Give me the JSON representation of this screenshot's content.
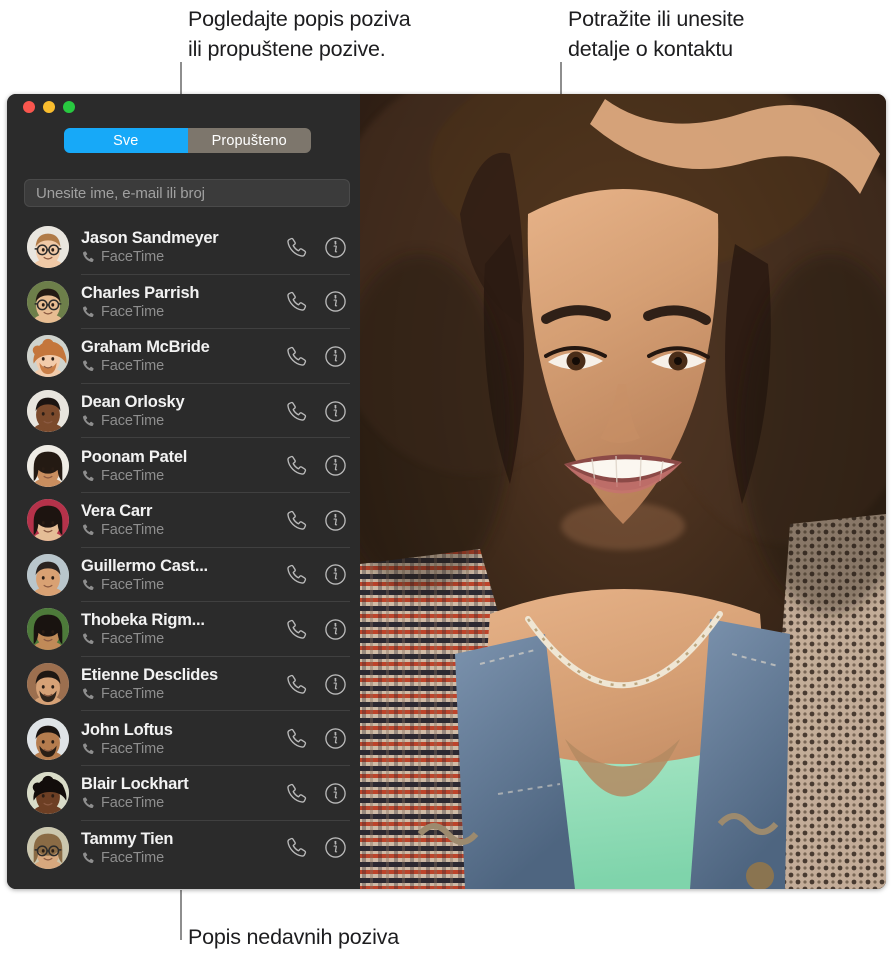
{
  "annotations": {
    "top_left": "Pogledajte popis poziva\nili propuštene pozive.",
    "top_right": "Potražite ili unesite\ndetalje o kontaktu",
    "bottom": "Popis nedavnih poziva"
  },
  "window": {
    "traffic_lights": [
      {
        "name": "close",
        "color": "#f9564e"
      },
      {
        "name": "minimize",
        "color": "#f9bd2e"
      },
      {
        "name": "zoom",
        "color": "#28c940"
      }
    ]
  },
  "toolbar": {
    "segments": [
      {
        "label": "Sve",
        "selected": true,
        "color": "#17a9f8"
      },
      {
        "label": "Propušteno",
        "selected": false,
        "color": "#7d766c"
      }
    ]
  },
  "search": {
    "value": "",
    "placeholder": "Unesite ime, e-mail ili broj"
  },
  "contacts": {
    "action_labels": {
      "call": "call-button",
      "info": "info-button"
    },
    "items": [
      {
        "name": "Jason Sandmeyer",
        "service": "FaceTime"
      },
      {
        "name": "Charles Parrish",
        "service": "FaceTime"
      },
      {
        "name": "Graham McBride",
        "service": "FaceTime"
      },
      {
        "name": "Dean Orlosky",
        "service": "FaceTime"
      },
      {
        "name": "Poonam Patel",
        "service": "FaceTime"
      },
      {
        "name": "Vera Carr",
        "service": "FaceTime"
      },
      {
        "name": "Guillermo Cast...",
        "service": "FaceTime"
      },
      {
        "name": "Thobeka Rigm...",
        "service": "FaceTime"
      },
      {
        "name": "Etienne Desclides",
        "service": "FaceTime"
      },
      {
        "name": "John Loftus",
        "service": "FaceTime"
      },
      {
        "name": "Blair Lockhart",
        "service": "FaceTime"
      },
      {
        "name": "Tammy Tien",
        "service": "FaceTime"
      }
    ]
  },
  "video": {
    "description": "facetime-video-preview"
  },
  "colors": {
    "window_background": "#2b2b2b",
    "accent_blue": "#17a9f8",
    "segment_inactive": "#7d766c",
    "text_primary": "#f2f2f2",
    "text_secondary": "#8e8e8e",
    "divider": "#404040",
    "callout_line": "#8e8e8e"
  }
}
